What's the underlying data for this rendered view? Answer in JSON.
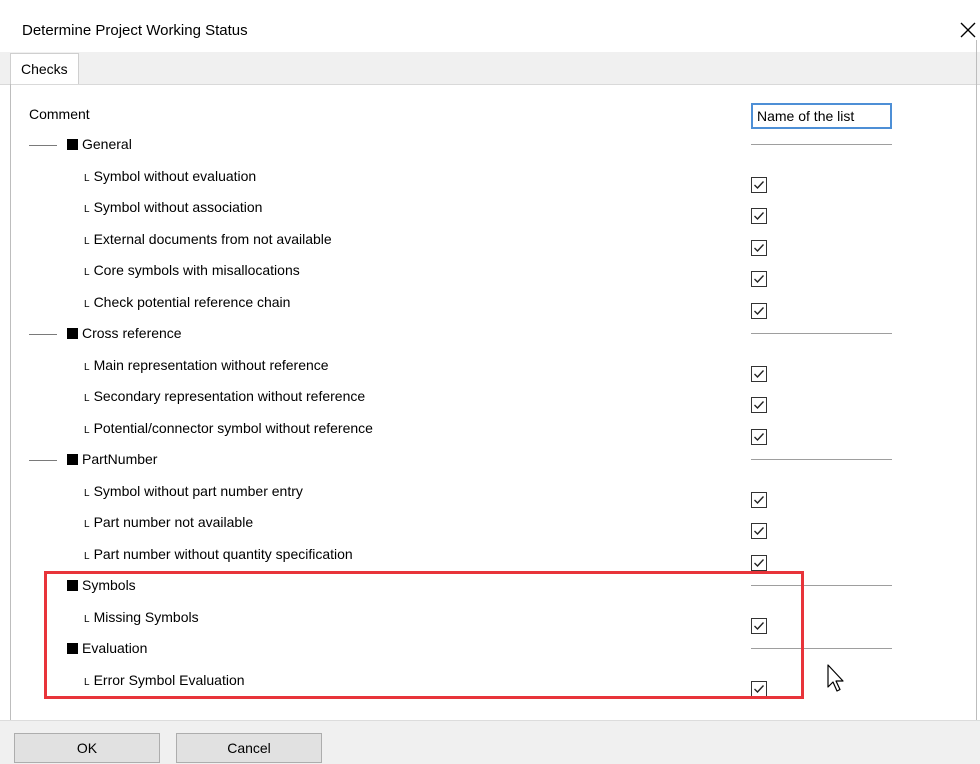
{
  "window": {
    "title": "Determine Project Working Status"
  },
  "tabs": [
    {
      "label": "Checks"
    }
  ],
  "list": {
    "comment_label": "Comment",
    "column_header": "Name of the list",
    "groups": [
      {
        "label": "General",
        "items": [
          {
            "label": "Symbol without evaluation",
            "checked": true
          },
          {
            "label": "Symbol without association",
            "checked": true
          },
          {
            "label": "External documents from  not available",
            "checked": true
          },
          {
            "label": "Core symbols with misallocations",
            "checked": true
          },
          {
            "label": "Check potential reference chain",
            "checked": true
          }
        ]
      },
      {
        "label": "Cross reference",
        "items": [
          {
            "label": "Main representation without reference",
            "checked": true
          },
          {
            "label": "Secondary representation without reference",
            "checked": true
          },
          {
            "label": "Potential/connector symbol without reference",
            "checked": true
          }
        ]
      },
      {
        "label": "PartNumber",
        "items": [
          {
            "label": "Symbol without part number entry",
            "checked": true
          },
          {
            "label": "Part number not available",
            "checked": true
          },
          {
            "label": "Part number without quantity specification",
            "checked": true
          }
        ]
      },
      {
        "label": "Symbols",
        "items": [
          {
            "label": "Missing Symbols",
            "checked": true
          }
        ]
      },
      {
        "label": "Evaluation",
        "items": [
          {
            "label": "Error Symbol Evaluation",
            "checked": true
          }
        ]
      }
    ]
  },
  "buttons": {
    "ok": "OK",
    "cancel": "Cancel"
  },
  "colors": {
    "highlight": "#e8343a",
    "header_border": "#4d8fd6"
  },
  "glyphs": {
    "item_prefix": "L"
  }
}
